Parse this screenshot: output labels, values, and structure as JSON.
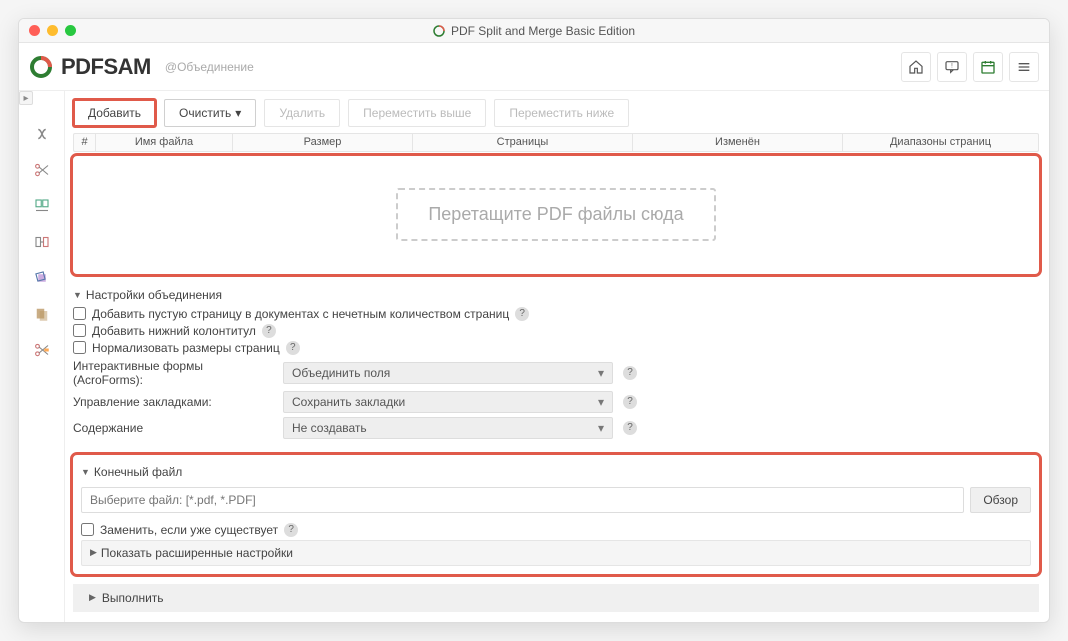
{
  "window": {
    "title": "PDF Split and Merge Basic Edition"
  },
  "brand": {
    "name": "PDFSAM",
    "breadcrumb": "@Объединение"
  },
  "header_icons": {
    "home": "home-icon",
    "notify": "notify-icon",
    "calendar": "calendar-icon",
    "menu": "menu-icon"
  },
  "sidebar": {
    "items": [
      {
        "name": "merge-icon"
      },
      {
        "name": "split-scissors-icon"
      },
      {
        "name": "split-bookmark-icon"
      },
      {
        "name": "extract-icon"
      },
      {
        "name": "rotate-icon"
      },
      {
        "name": "mix-icon"
      },
      {
        "name": "split-size-icon"
      }
    ]
  },
  "toolbar": {
    "add": "Добавить",
    "clear": "Очистить",
    "delete": "Удалить",
    "move_up": "Переместить выше",
    "move_down": "Переместить ниже"
  },
  "table": {
    "col_num": "#",
    "col_name": "Имя файла",
    "col_size": "Размер",
    "col_pages": "Страницы",
    "col_modified": "Изменён",
    "col_ranges": "Диапазоны страниц"
  },
  "dropzone": {
    "hint": "Перетащите PDF файлы сюда"
  },
  "merge_settings": {
    "title": "Настройки объединения",
    "add_blank": "Добавить пустую страницу в документах с нечетным количеством страниц",
    "add_footer": "Добавить нижний колонтитул",
    "normalize": "Нормализовать размеры страниц",
    "forms_label": "Интерактивные формы (AcroForms):",
    "forms_value": "Объединить поля",
    "bookmarks_label": "Управление закладками:",
    "bookmarks_value": "Сохранить закладки",
    "toc_label": "Содержание",
    "toc_value": "Не создавать"
  },
  "output": {
    "title": "Конечный файл",
    "placeholder": "Выберите файл: [*.pdf, *.PDF]",
    "browse": "Обзор",
    "overwrite": "Заменить, если уже существует",
    "advanced": "Показать расширенные настройки"
  },
  "run": {
    "label": "Выполнить"
  }
}
